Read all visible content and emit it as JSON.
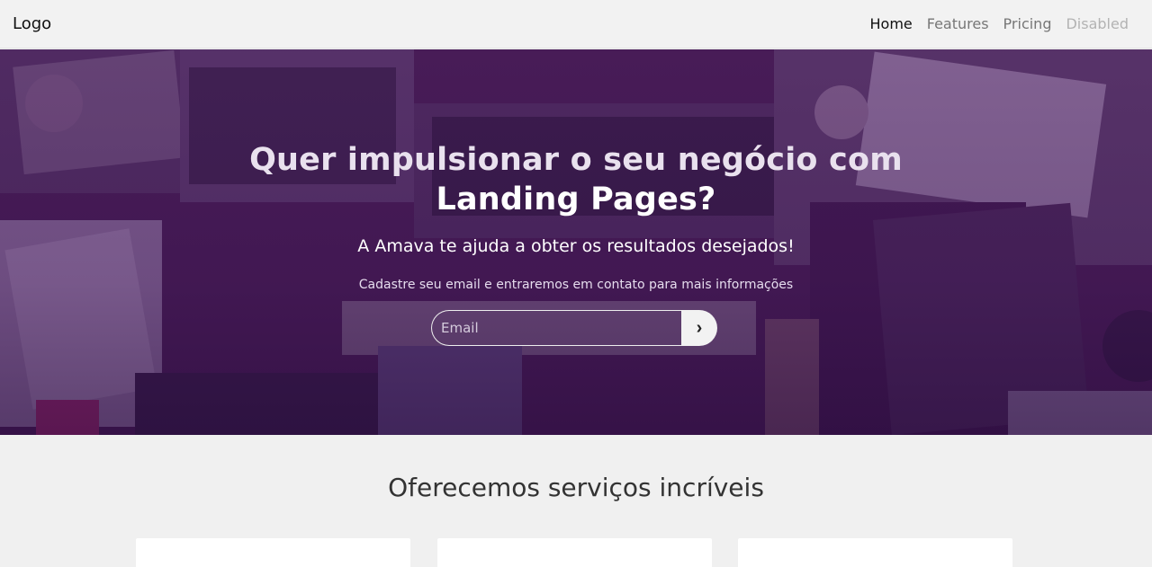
{
  "navbar": {
    "logo": "Logo",
    "links": [
      {
        "label": "Home",
        "state": "active"
      },
      {
        "label": "Features",
        "state": "normal"
      },
      {
        "label": "Pricing",
        "state": "normal"
      },
      {
        "label": "Disabled",
        "state": "disabled"
      }
    ]
  },
  "hero": {
    "title_line1": "Quer impulsionar o seu negócio com",
    "title_line2": "Landing Pages?",
    "subtitle": "A Amava te ajuda a obter os resultados desejados!",
    "description": "Cadastre seu email e entraremos em contato para mais informações",
    "email_placeholder": "Email",
    "email_value": "",
    "submit_icon": "chevron-right-icon",
    "submit_glyph": "›",
    "overlay_color": "#461062"
  },
  "services": {
    "title": "Oferecemos serviços incríveis",
    "cards": [
      {},
      {},
      {}
    ]
  }
}
